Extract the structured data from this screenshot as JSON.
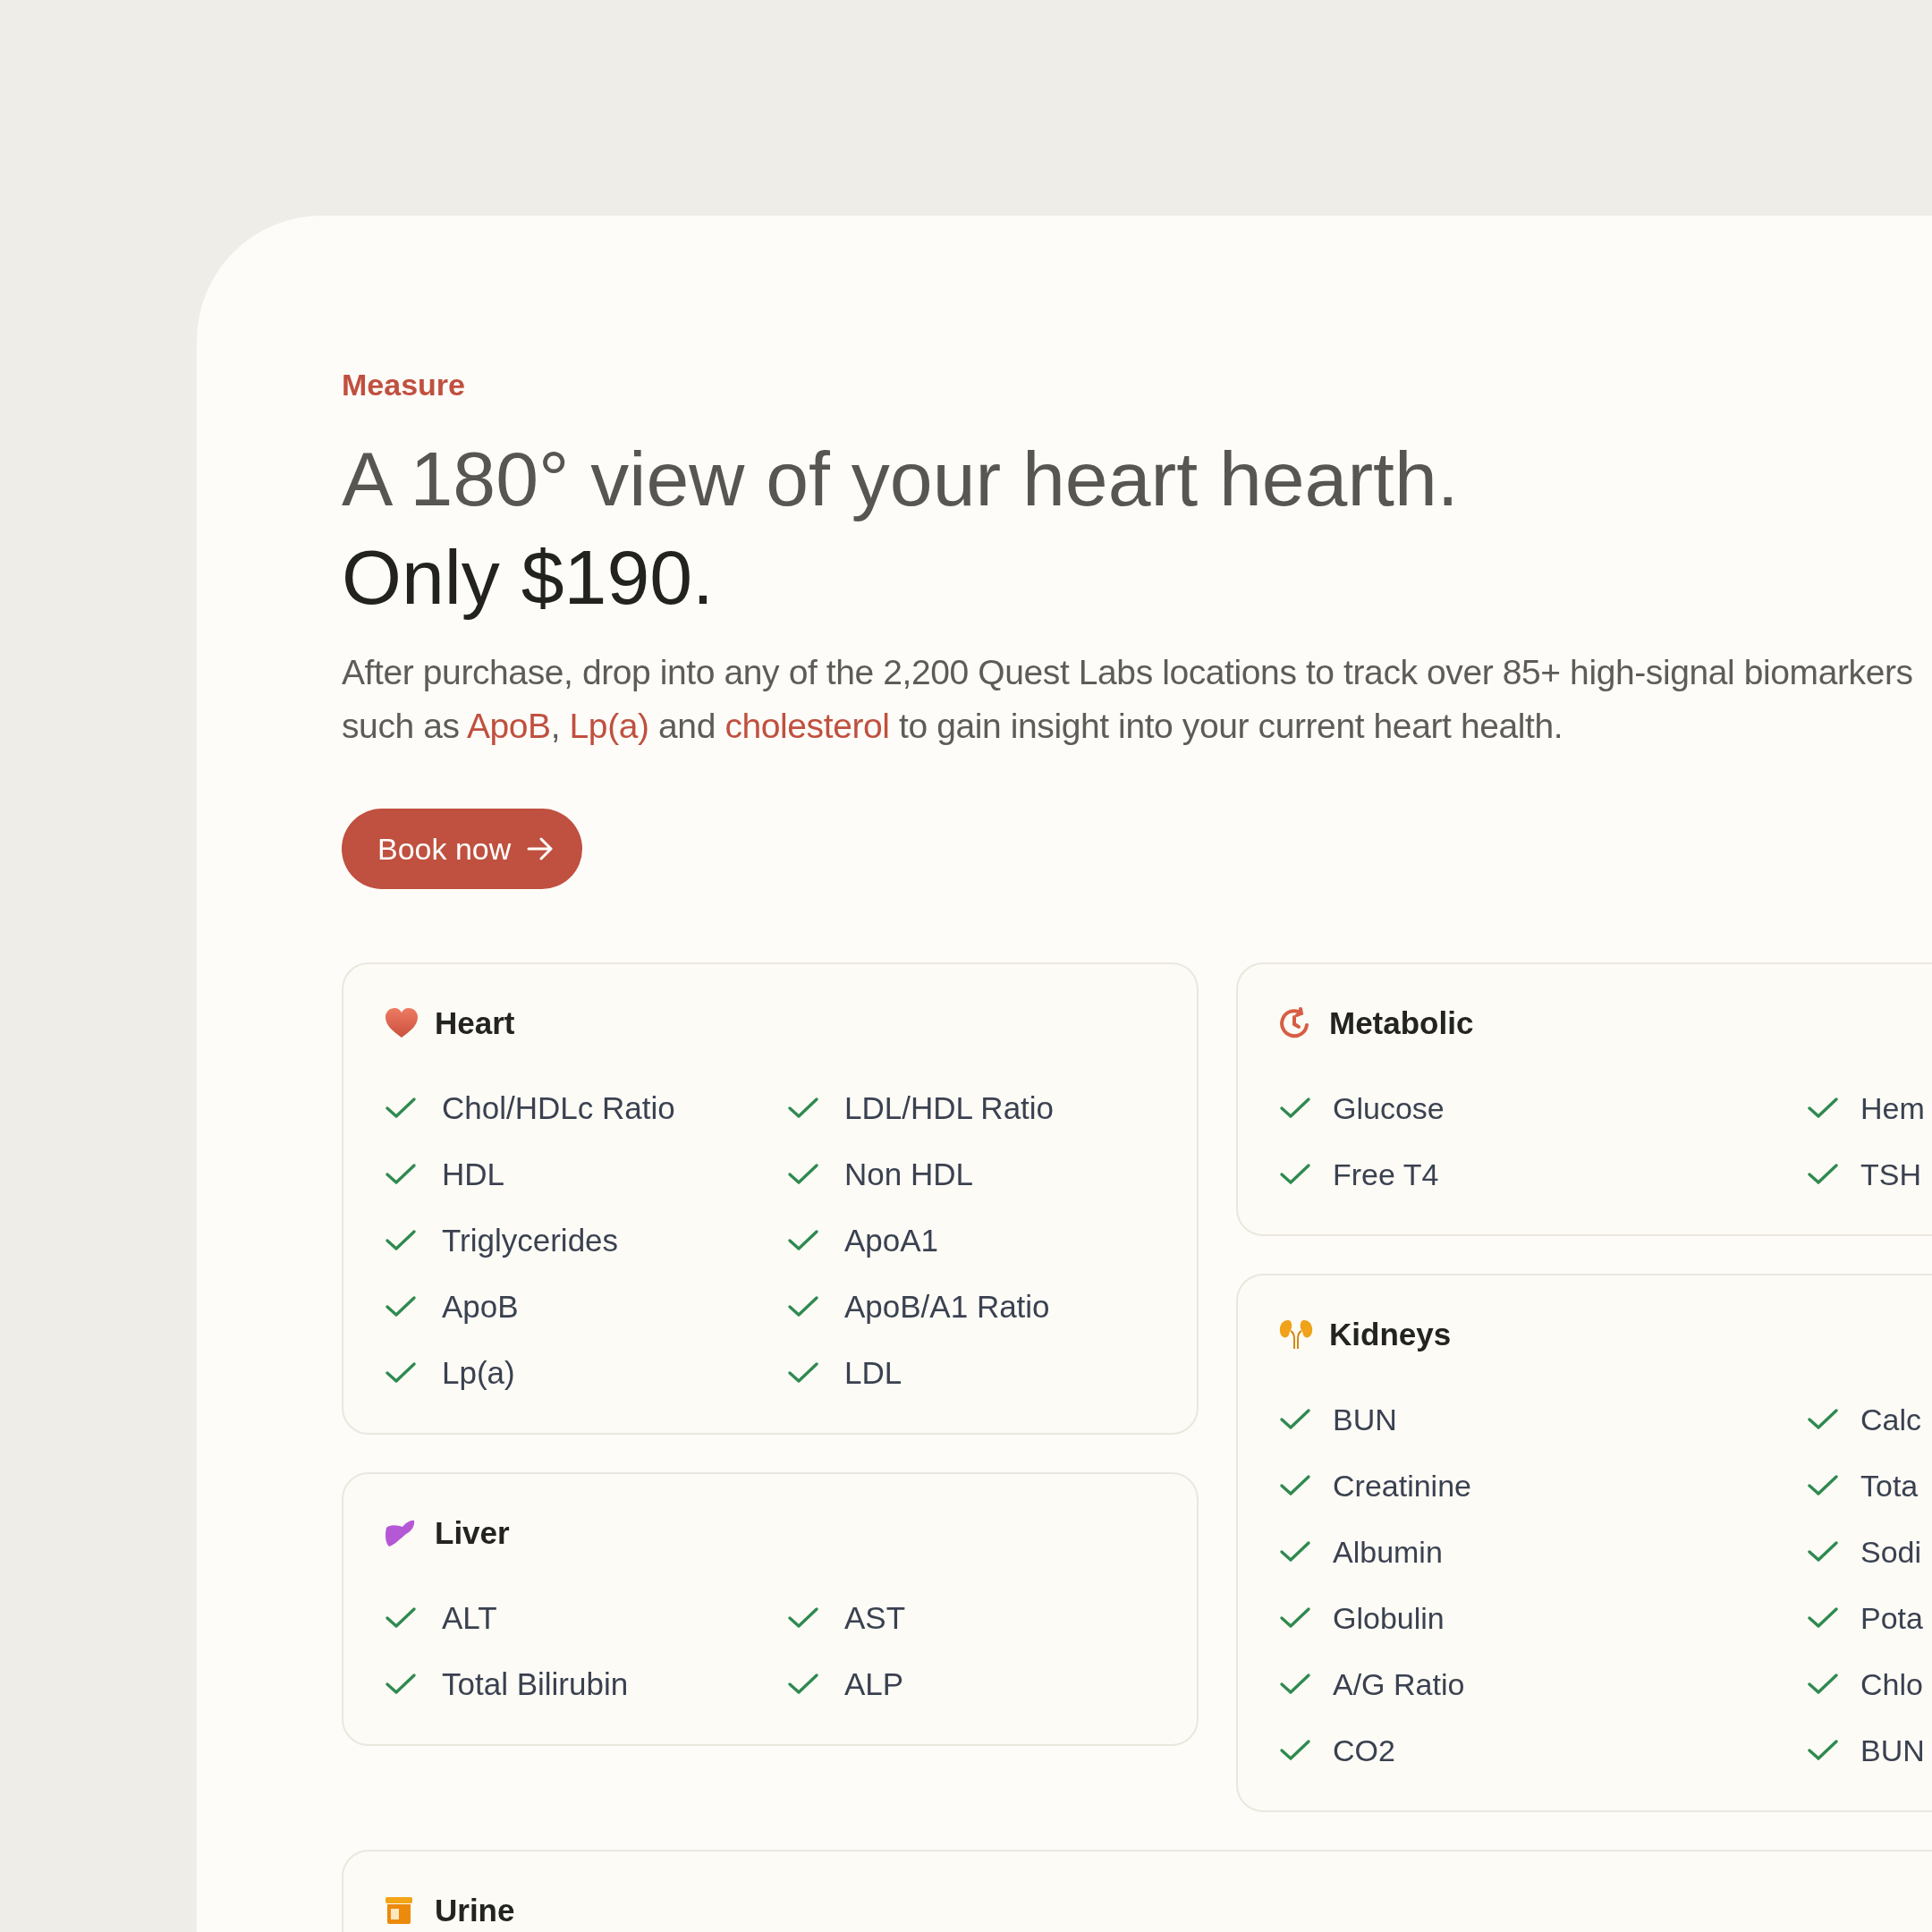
{
  "eyebrow": "Measure",
  "headline": "A 180° view of your heart hearth.",
  "price": "Only $190.",
  "description": [
    {
      "kind": "text",
      "text": "After purchase, drop into any of the 2,200 Quest Labs locations to track over 85+ high-signal biomarkers such as "
    },
    {
      "kind": "link",
      "text": "ApoB"
    },
    {
      "kind": "text",
      "text": ", "
    },
    {
      "kind": "link",
      "text": "Lp(a)"
    },
    {
      "kind": "text",
      "text": " and "
    },
    {
      "kind": "link",
      "text": "cholesterol"
    },
    {
      "kind": "text",
      "text": " to gain insight into your current heart health."
    }
  ],
  "cta": {
    "label": "Book now"
  },
  "left_column": [
    {
      "kind": "heart",
      "title": "Heart",
      "items": [
        "Chol/HDLc Ratio",
        "LDL/HDL Ratio",
        "HDL",
        "Non HDL",
        "Triglycerides",
        "ApoA1",
        "ApoB",
        "ApoB/A1 Ratio",
        "Lp(a)",
        "LDL"
      ]
    },
    {
      "kind": "liver",
      "title": "Liver",
      "items": [
        "ALT",
        "AST",
        "Total Bilirubin",
        "ALP"
      ]
    }
  ],
  "right_column": [
    {
      "kind": "metabolic",
      "title": "Metabolic",
      "items": [
        "Glucose",
        "Hem",
        "Free T4",
        "TSH"
      ]
    },
    {
      "kind": "kidneys",
      "title": "Kidneys",
      "items": [
        "BUN",
        "Calc",
        "Creatinine",
        "Tota",
        "Albumin",
        "Sodi",
        "Globulin",
        "Pota",
        "A/G Ratio",
        "Chlo",
        "CO2",
        "BUN"
      ]
    }
  ],
  "bottom_panel": {
    "kind": "urine",
    "title": "Urine"
  }
}
